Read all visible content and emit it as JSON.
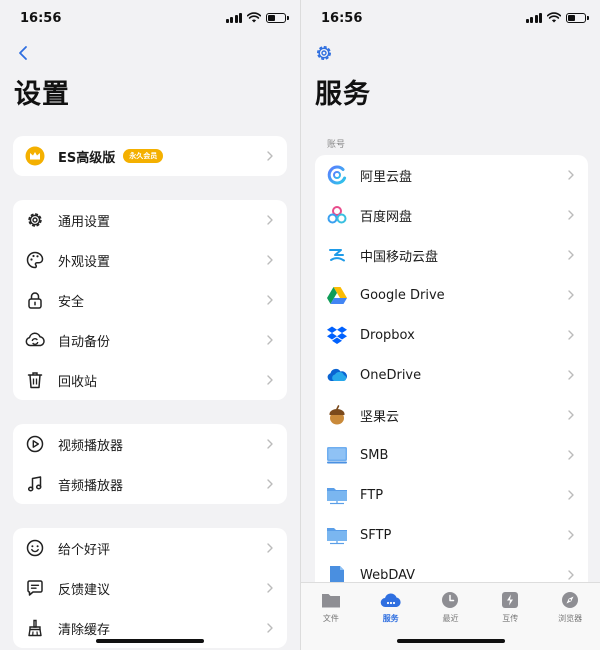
{
  "status": {
    "time": "16:56"
  },
  "left": {
    "title": "设置",
    "premium": {
      "label": "ES高级版",
      "badge": "永久会员"
    },
    "group1": [
      {
        "label": "通用设置",
        "icon": "gear-icon"
      },
      {
        "label": "外观设置",
        "icon": "palette-icon"
      },
      {
        "label": "安全",
        "icon": "lock-icon"
      },
      {
        "label": "自动备份",
        "icon": "cloud-sync-icon"
      },
      {
        "label": "回收站",
        "icon": "trash-icon"
      }
    ],
    "group2": [
      {
        "label": "视频播放器",
        "icon": "play-circle-icon"
      },
      {
        "label": "音频播放器",
        "icon": "music-note-icon"
      }
    ],
    "group3": [
      {
        "label": "给个好评",
        "icon": "smile-icon"
      },
      {
        "label": "反馈建议",
        "icon": "chat-icon"
      },
      {
        "label": "清除缓存",
        "icon": "broom-icon"
      }
    ]
  },
  "right": {
    "title": "服务",
    "section_label": "账号",
    "services": [
      {
        "label": "阿里云盘",
        "icon": "aliyun-drive-icon"
      },
      {
        "label": "百度网盘",
        "icon": "baidu-netdisk-icon"
      },
      {
        "label": "中国移动云盘",
        "icon": "china-mobile-cloud-icon"
      },
      {
        "label": "Google Drive",
        "icon": "google-drive-icon"
      },
      {
        "label": "Dropbox",
        "icon": "dropbox-icon"
      },
      {
        "label": "OneDrive",
        "icon": "onedrive-icon"
      },
      {
        "label": "坚果云",
        "icon": "nutstore-icon"
      },
      {
        "label": "SMB",
        "icon": "smb-icon"
      },
      {
        "label": "FTP",
        "icon": "ftp-folder-icon"
      },
      {
        "label": "SFTP",
        "icon": "sftp-folder-icon"
      },
      {
        "label": "WebDAV",
        "icon": "webdav-icon"
      }
    ],
    "tabs": [
      {
        "label": "文件",
        "icon": "folder-icon",
        "active": false
      },
      {
        "label": "服务",
        "icon": "cloud-icon",
        "active": true
      },
      {
        "label": "最近",
        "icon": "clock-icon",
        "active": false
      },
      {
        "label": "互传",
        "icon": "transfer-icon",
        "active": false
      },
      {
        "label": "浏览器",
        "icon": "compass-icon",
        "active": false
      }
    ]
  },
  "colors": {
    "accent": "#2f6fe0",
    "badge": "#f4b000",
    "background": "#f2f2f4"
  }
}
